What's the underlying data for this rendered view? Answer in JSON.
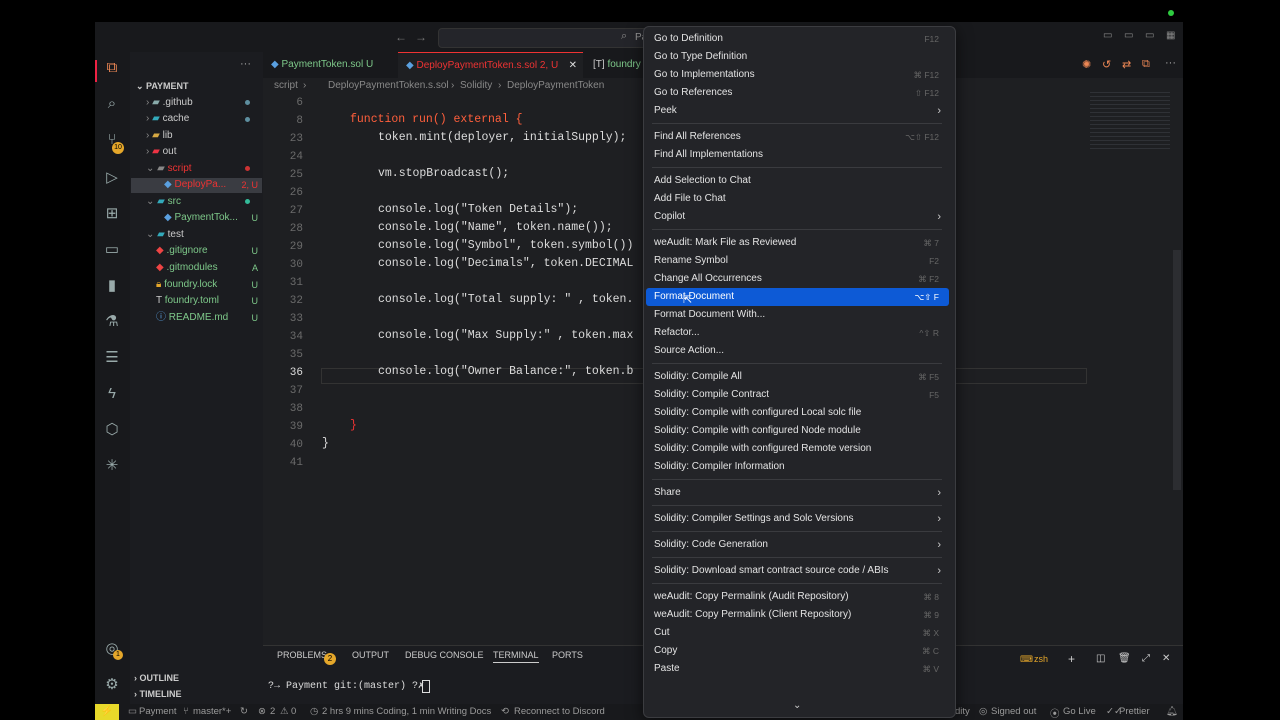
{
  "title": {
    "search_text": "Pa"
  },
  "activity": {
    "badge_scm": "10",
    "badge_accounts": "1"
  },
  "sidebar": {
    "header": "PAYMENT",
    "items": [
      {
        "label": ".github",
        "status": ""
      },
      {
        "label": "cache",
        "status": ""
      },
      {
        "label": "lib",
        "status": ""
      },
      {
        "label": "out",
        "status": ""
      },
      {
        "label": "script",
        "status": ""
      },
      {
        "label": "DeployPa...",
        "status": "2, U"
      },
      {
        "label": "src",
        "status": ""
      },
      {
        "label": "PaymentTok...",
        "status": "U"
      },
      {
        "label": "test",
        "status": ""
      },
      {
        "label": ".gitignore",
        "status": "U"
      },
      {
        "label": ".gitmodules",
        "status": "A"
      },
      {
        "label": "foundry.lock",
        "status": "U"
      },
      {
        "label": "foundry.toml",
        "status": "U"
      },
      {
        "label": "README.md",
        "status": "U"
      }
    ],
    "outline": "OUTLINE",
    "timeline": "TIMELINE"
  },
  "tabs": [
    {
      "label": "PaymentToken.sol",
      "status": "U"
    },
    {
      "label": "DeployPaymentToken.s.sol",
      "status": "2, U"
    },
    {
      "label": "foundry",
      "status": ""
    }
  ],
  "breadcrumb": [
    "script",
    "DeployPaymentToken.s.sol",
    "Solidity",
    "DeployPaymentToken"
  ],
  "code": {
    "lines": [
      {
        "n": "6",
        "t": ""
      },
      {
        "n": "8",
        "t": "function run() external {"
      },
      {
        "n": "23",
        "t": "token.mint(deployer, initialSupply);"
      },
      {
        "n": "24",
        "t": ""
      },
      {
        "n": "25",
        "t": "vm.stopBroadcast();"
      },
      {
        "n": "26",
        "t": ""
      },
      {
        "n": "27",
        "t": "console.log(\"Token Details\");"
      },
      {
        "n": "28",
        "t": "console.log(\"Name\", token.name());"
      },
      {
        "n": "29",
        "t": "console.log(\"Symbol\", token.symbol())"
      },
      {
        "n": "30",
        "t": "console.log(\"Decimals\", token.DECIMAL"
      },
      {
        "n": "31",
        "t": ""
      },
      {
        "n": "32",
        "t": "console.log(\"Total supply: \" , token."
      },
      {
        "n": "33",
        "t": ""
      },
      {
        "n": "34",
        "t": "console.log(\"Max Supply:\" , token.max"
      },
      {
        "n": "35",
        "t": ""
      },
      {
        "n": "36",
        "t": "console.log(\"Owner Balance:\", token.b"
      },
      {
        "n": "37",
        "t": ""
      },
      {
        "n": "38",
        "t": ""
      },
      {
        "n": "39",
        "t": "}"
      },
      {
        "n": "40",
        "t": "}"
      },
      {
        "n": "41",
        "t": ""
      }
    ]
  },
  "panel": {
    "tabs": [
      "PROBLEMS",
      "OUTPUT",
      "DEBUG CONSOLE",
      "TERMINAL",
      "PORTS"
    ],
    "problems_count": "2",
    "terminal_line": "?→ Payment git:(master) ?✗",
    "shell": "zsh"
  },
  "status": {
    "remote": "⚡",
    "folder": "Payment",
    "branch": "master*+",
    "errors": "2",
    "warnings": "0",
    "time": "2 hrs 9 mins Coding, 1 min Writing Docs",
    "discord": "Reconnect to Discord",
    "solidity": "dity",
    "signed": "Signed out",
    "golive": "Go Live",
    "prettier": "Prettier"
  },
  "menu": {
    "groups": [
      [
        {
          "label": "Go to Definition",
          "key": "F12"
        },
        {
          "label": "Go to Type Definition",
          "key": ""
        },
        {
          "label": "Go to Implementations",
          "key": "⌘ F12"
        },
        {
          "label": "Go to References",
          "key": "⇧ F12"
        },
        {
          "label": "Peek",
          "key": "",
          "sub": true
        }
      ],
      [
        {
          "label": "Find All References",
          "key": "⌥⇧ F12"
        },
        {
          "label": "Find All Implementations",
          "key": ""
        }
      ],
      [
        {
          "label": "Add Selection to Chat",
          "key": ""
        },
        {
          "label": "Add File to Chat",
          "key": ""
        },
        {
          "label": "Copilot",
          "key": "",
          "sub": true
        }
      ],
      [
        {
          "label": "weAudit: Mark File as Reviewed",
          "key": "⌘ 7"
        },
        {
          "label": "Rename Symbol",
          "key": "F2"
        },
        {
          "label": "Change All Occurrences",
          "key": "⌘ F2"
        },
        {
          "label": "Format Document",
          "key": "⌥⇧ F",
          "selected": true
        },
        {
          "label": "Format Document With...",
          "key": ""
        },
        {
          "label": "Refactor...",
          "key": "^⇧ R"
        },
        {
          "label": "Source Action...",
          "key": ""
        }
      ],
      [
        {
          "label": "Solidity: Compile All",
          "key": "⌘ F5"
        },
        {
          "label": "Solidity: Compile Contract",
          "key": "F5"
        },
        {
          "label": "Solidity: Compile with configured Local solc file",
          "key": ""
        },
        {
          "label": "Solidity: Compile with configured Node module",
          "key": ""
        },
        {
          "label": "Solidity: Compile with configured Remote version",
          "key": ""
        },
        {
          "label": "Solidity: Compiler Information",
          "key": ""
        }
      ],
      [
        {
          "label": "Share",
          "key": "",
          "sub": true
        }
      ],
      [
        {
          "label": "Solidity: Compiler Settings and Solc Versions",
          "key": "",
          "sub": true
        }
      ],
      [
        {
          "label": "Solidity: Code Generation",
          "key": "",
          "sub": true
        }
      ],
      [
        {
          "label": "Solidity: Download smart contract source code / ABIs",
          "key": "",
          "sub": true
        }
      ],
      [
        {
          "label": "weAudit: Copy Permalink (Audit Repository)",
          "key": "⌘ 8"
        },
        {
          "label": "weAudit: Copy Permalink (Client Repository)",
          "key": "⌘ 9"
        },
        {
          "label": "Cut",
          "key": "⌘ X"
        },
        {
          "label": "Copy",
          "key": "⌘ C"
        },
        {
          "label": "Paste",
          "key": "⌘ V"
        }
      ]
    ]
  },
  "colors": {
    "accent": "#0d5ad6",
    "untracked": "#73c991",
    "error": "#f14c4c",
    "keyword": "#ff5f3c"
  }
}
